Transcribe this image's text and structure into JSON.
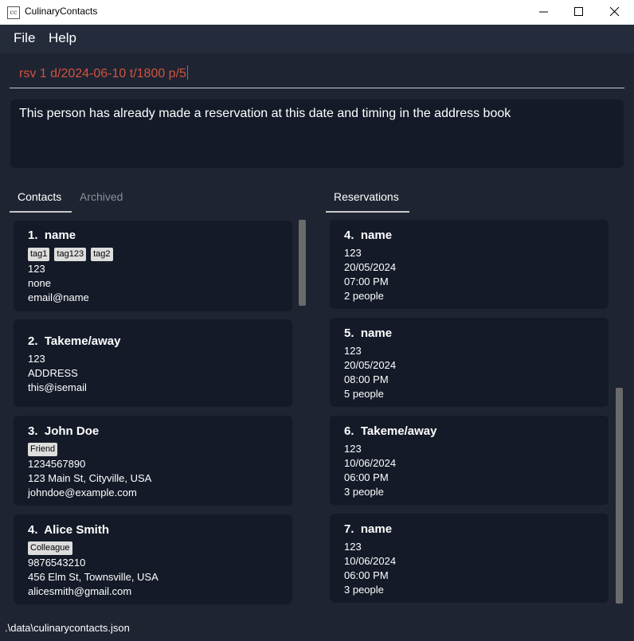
{
  "window": {
    "title": "CulinaryContacts",
    "icon_text": "cc"
  },
  "menu": {
    "file": "File",
    "help": "Help"
  },
  "command": {
    "value": "rsv 1 d/2024-06-10 t/1800 p/5"
  },
  "result": {
    "message": "This person has already made a reservation at this date and timing in the address book"
  },
  "tabs": {
    "contacts": "Contacts",
    "archived": "Archived",
    "reservations": "Reservations"
  },
  "contacts": [
    {
      "index": "1.",
      "name": "name",
      "tags": [
        "tag1",
        "tag123",
        "tag2"
      ],
      "phone": "123",
      "address": "none",
      "email": "email@name"
    },
    {
      "index": "2.",
      "name": "Takeme/away",
      "tags": [],
      "phone": "123",
      "address": "ADDRESS",
      "email": "this@isemail"
    },
    {
      "index": "3.",
      "name": "John Doe",
      "tags": [
        "Friend"
      ],
      "phone": "1234567890",
      "address": "123 Main St, Cityville, USA",
      "email": "johndoe@example.com"
    },
    {
      "index": "4.",
      "name": "Alice Smith",
      "tags": [
        "Colleague"
      ],
      "phone": "9876543210",
      "address": "456 Elm St, Townsville, USA",
      "email": "alicesmith@gmail.com"
    }
  ],
  "reservations": [
    {
      "index": "4.",
      "name": "name",
      "phone": "123",
      "date": "20/05/2024",
      "time": "07:00 PM",
      "pax": "2 people"
    },
    {
      "index": "5.",
      "name": "name",
      "phone": "123",
      "date": "20/05/2024",
      "time": "08:00 PM",
      "pax": "5 people"
    },
    {
      "index": "6.",
      "name": "Takeme/away",
      "phone": "123",
      "date": "10/06/2024",
      "time": "06:00 PM",
      "pax": "3 people"
    },
    {
      "index": "7.",
      "name": "name",
      "phone": "123",
      "date": "10/06/2024",
      "time": "06:00 PM",
      "pax": "3 people"
    }
  ],
  "status": {
    "file_path": ".\\data\\culinarycontacts.json"
  },
  "colors": {
    "background": "#1e2432",
    "card": "#141a28",
    "command_text": "#d0533e",
    "tag": "#dddddd"
  }
}
